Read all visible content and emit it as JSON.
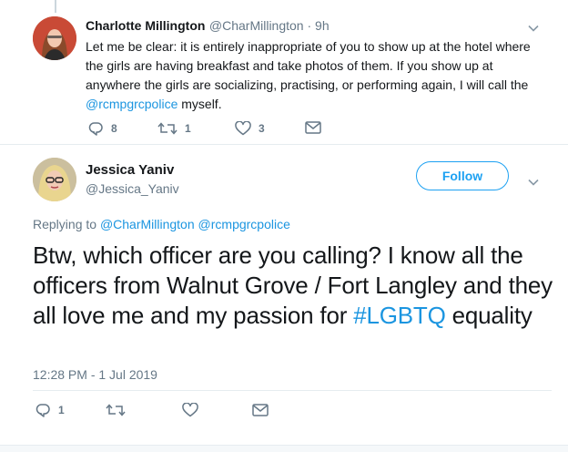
{
  "tweet1": {
    "name": "Charlotte Millington",
    "handle": "@CharMillington",
    "time_sep": " · ",
    "time": "9h",
    "text_part1": "Let me be clear: it is entirely inappropriate of you to show up at the hotel where the girls are having breakfast and take photos of them. If you show up at anywhere the girls are socializing, practising, or performing again, I will call the ",
    "mention": "@rcmpgrcpolice",
    "text_part2": " myself.",
    "reply_count": "8",
    "retweet_count": "1",
    "like_count": "3"
  },
  "tweet2": {
    "name": "Jessica Yaniv",
    "handle": "@Jessica_Yaniv",
    "follow_label": "Follow",
    "replying_label": "Replying to ",
    "replying_mention1": "@CharMillington",
    "replying_mention2": "@rcmpgrcpolice",
    "text_part1": "Btw, which officer are you calling? I know all the officers from Walnut Grove / Fort Langley and they all love me and my passion for ",
    "hashtag": "#LGBTQ",
    "text_part2": " equality",
    "timestamp": "12:28 PM - 1 Jul 2019",
    "reply_count": "1"
  },
  "colors": {
    "link": "#1b95e0",
    "secondary_text": "#657786",
    "follow_blue": "#1da1f2"
  },
  "icons": [
    "chevron-down-icon",
    "reply-icon",
    "retweet-icon",
    "like-icon",
    "message-icon"
  ]
}
